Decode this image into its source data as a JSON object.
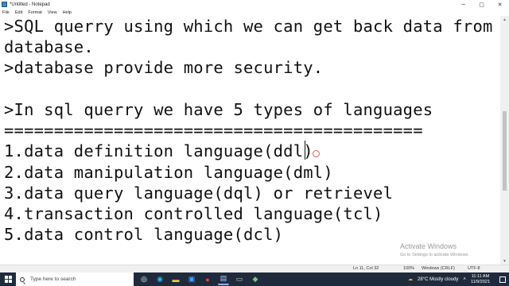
{
  "window": {
    "title": "*Untitled - Notepad",
    "controls": {
      "minimize": "─",
      "maximize": "▢",
      "close": "✕"
    }
  },
  "menu": [
    "File",
    "Edit",
    "Format",
    "View",
    "Help"
  ],
  "editor": {
    "lines": [
      ">SQL querry using which we can get back data from",
      "database.",
      ">database provide more security.",
      "",
      ">In sql querry we have 5 types of languages",
      "==========================================",
      "1.data definition language(ddl)",
      "2.data manipulation language(dml)",
      "3.data query language(dql) or retrievel",
      "4.transaction controlled language(tcl)",
      "5.data control language(dcl)"
    ]
  },
  "status": {
    "position": "Ln 11, Col 32",
    "zoom": "100%",
    "line_ending": "Windows (CRLF)",
    "encoding": "UTF-8"
  },
  "watermark": {
    "title": "Activate Windows",
    "subtitle": "Go to Settings to activate Windows."
  },
  "taskbar": {
    "search_placeholder": "Type here to search",
    "weather": "28°C  Mostly cloudy",
    "time": "11:11 AM",
    "date": "11/9/2021",
    "icons": [
      "task-view-icon",
      "edge-icon",
      "file-explorer-icon",
      "store-icon",
      "chrome-icon",
      "notepad-icon",
      "cmd-icon",
      "app-icon"
    ]
  }
}
